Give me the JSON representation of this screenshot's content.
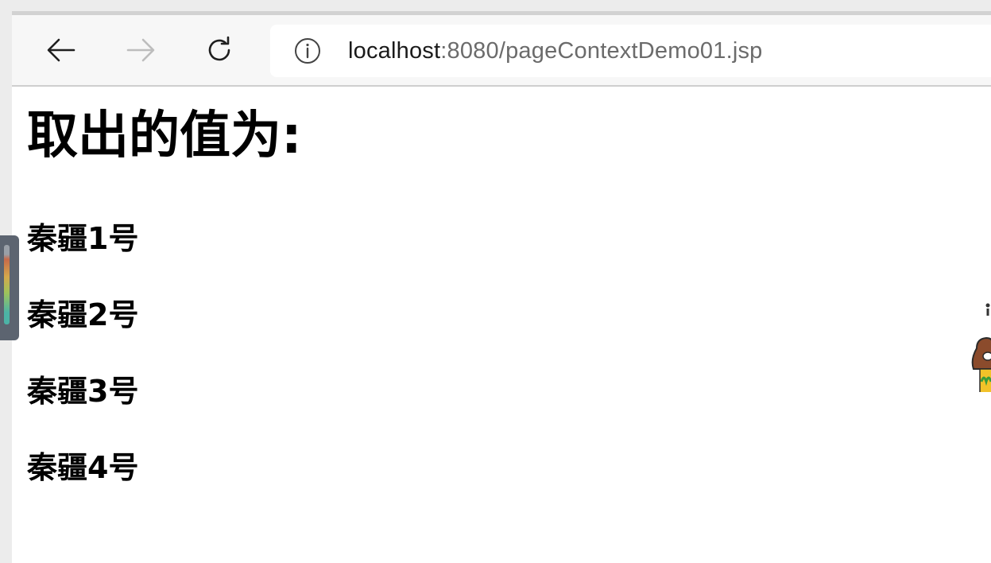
{
  "browser": {
    "url_host": "localhost",
    "url_path": ":8080/pageContextDemo01.jsp",
    "back_icon": "arrow-left-icon",
    "forward_icon": "arrow-right-icon",
    "reload_icon": "reload-icon",
    "site_info_icon": "info-circle-icon"
  },
  "page": {
    "heading": "取出的值为:",
    "items": [
      "秦疆1号",
      "秦疆2号",
      "秦疆3号",
      "秦疆4号"
    ]
  },
  "colors": {
    "toolbar_bg": "#f7f7f7",
    "url_host": "#1a1a1a",
    "url_path": "#6b6b6b",
    "forward_disabled": "#bdbdbd"
  }
}
